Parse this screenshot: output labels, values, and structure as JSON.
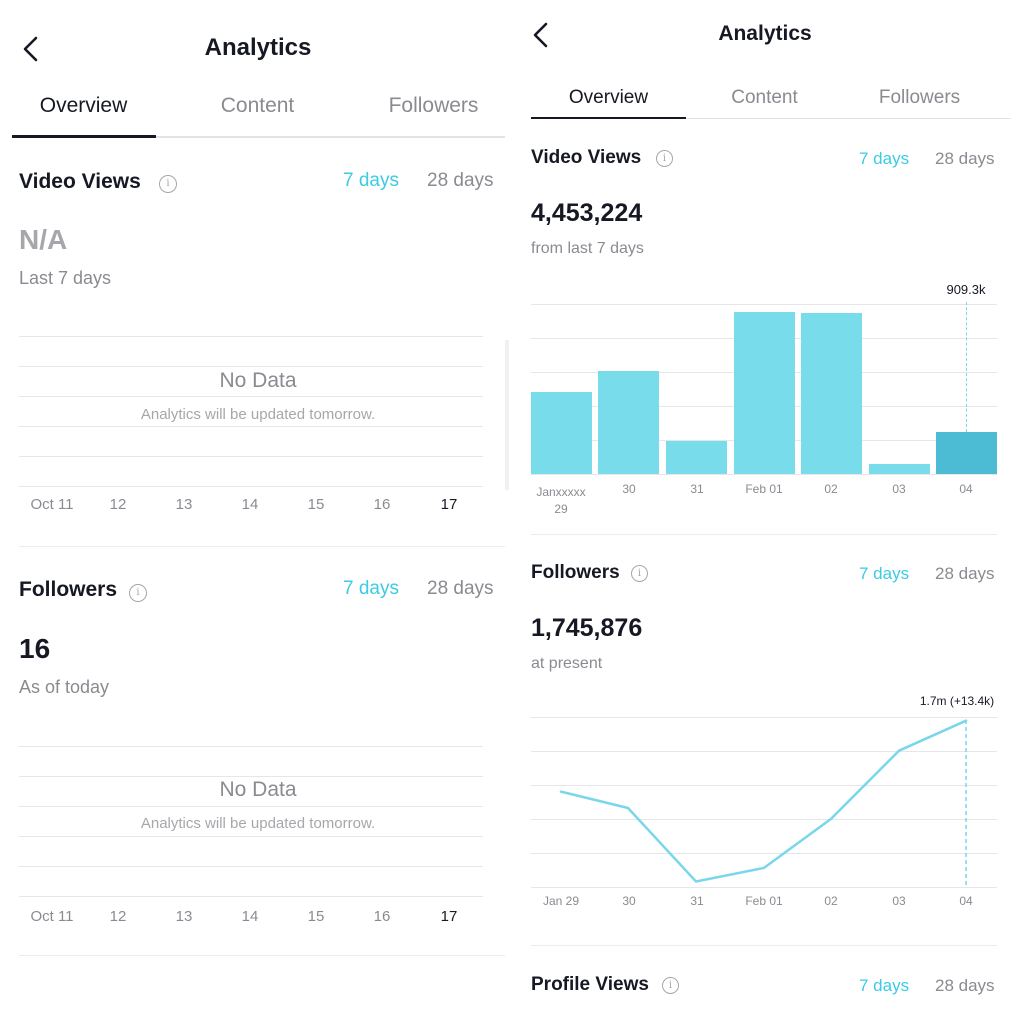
{
  "left": {
    "header": {
      "title": "Analytics",
      "back_icon": "chevron-left-icon"
    },
    "tabs": [
      "Overview",
      "Content",
      "Followers"
    ],
    "video_views": {
      "title": "Video Views",
      "range_7": "7 days",
      "range_28": "28 days",
      "value": "N/A",
      "subtitle": "Last 7 days",
      "no_data": "No Data",
      "no_data_sub": "Analytics will be updated tomorrow.",
      "ticks": [
        "Oct 11",
        "12",
        "13",
        "14",
        "15",
        "16",
        "17"
      ]
    },
    "followers": {
      "title": "Followers",
      "range_7": "7 days",
      "range_28": "28 days",
      "value": "16",
      "subtitle": "As of today",
      "no_data": "No Data",
      "no_data_sub": "Analytics will be updated tomorrow.",
      "ticks": [
        "Oct 11",
        "12",
        "13",
        "14",
        "15",
        "16",
        "17"
      ]
    }
  },
  "right": {
    "header": {
      "title": "Analytics",
      "back_icon": "chevron-left-icon"
    },
    "tabs": [
      "Overview",
      "Content",
      "Followers"
    ],
    "video_views": {
      "title": "Video Views",
      "range_7": "7 days",
      "range_28": "28 days",
      "value": "4,453,224",
      "subtitle": "from last 7 days",
      "tooltip": "909.3k",
      "ticks": [
        "Janxxxxx\n29",
        "30",
        "31",
        "Feb 01",
        "02",
        "03",
        "04"
      ]
    },
    "followers": {
      "title": "Followers",
      "range_7": "7 days",
      "range_28": "28 days",
      "value": "1,745,876",
      "subtitle": "at present",
      "tooltip": "1.7m (+13.4k)",
      "ticks": [
        "Jan 29",
        "30",
        "31",
        "Feb 01",
        "02",
        "03",
        "04"
      ]
    },
    "profile_views": {
      "title": "Profile Views",
      "range_7": "7 days",
      "range_28": "28 days"
    }
  },
  "colors": {
    "accent": "#3bcbe4",
    "bar": "#78dceb",
    "bar_highlight": "#4cbcd4",
    "line": "#7ad6ea"
  },
  "chart_data": [
    {
      "type": "bar",
      "categories": [
        "Janxxxxx 29",
        "30",
        "31",
        "Feb 01",
        "02",
        "03",
        "04"
      ],
      "values": [
        480,
        605,
        195,
        955,
        945,
        60,
        250
      ],
      "highlight_index": 6
    },
    {
      "type": "line",
      "categories": [
        "Jan 29",
        "30",
        "31",
        "Feb 01",
        "02",
        "03",
        "04"
      ],
      "values": [
        1725000,
        1719000,
        1692000,
        1697000,
        1715000,
        1740000,
        1751000
      ],
      "highlight_index": 6
    }
  ]
}
